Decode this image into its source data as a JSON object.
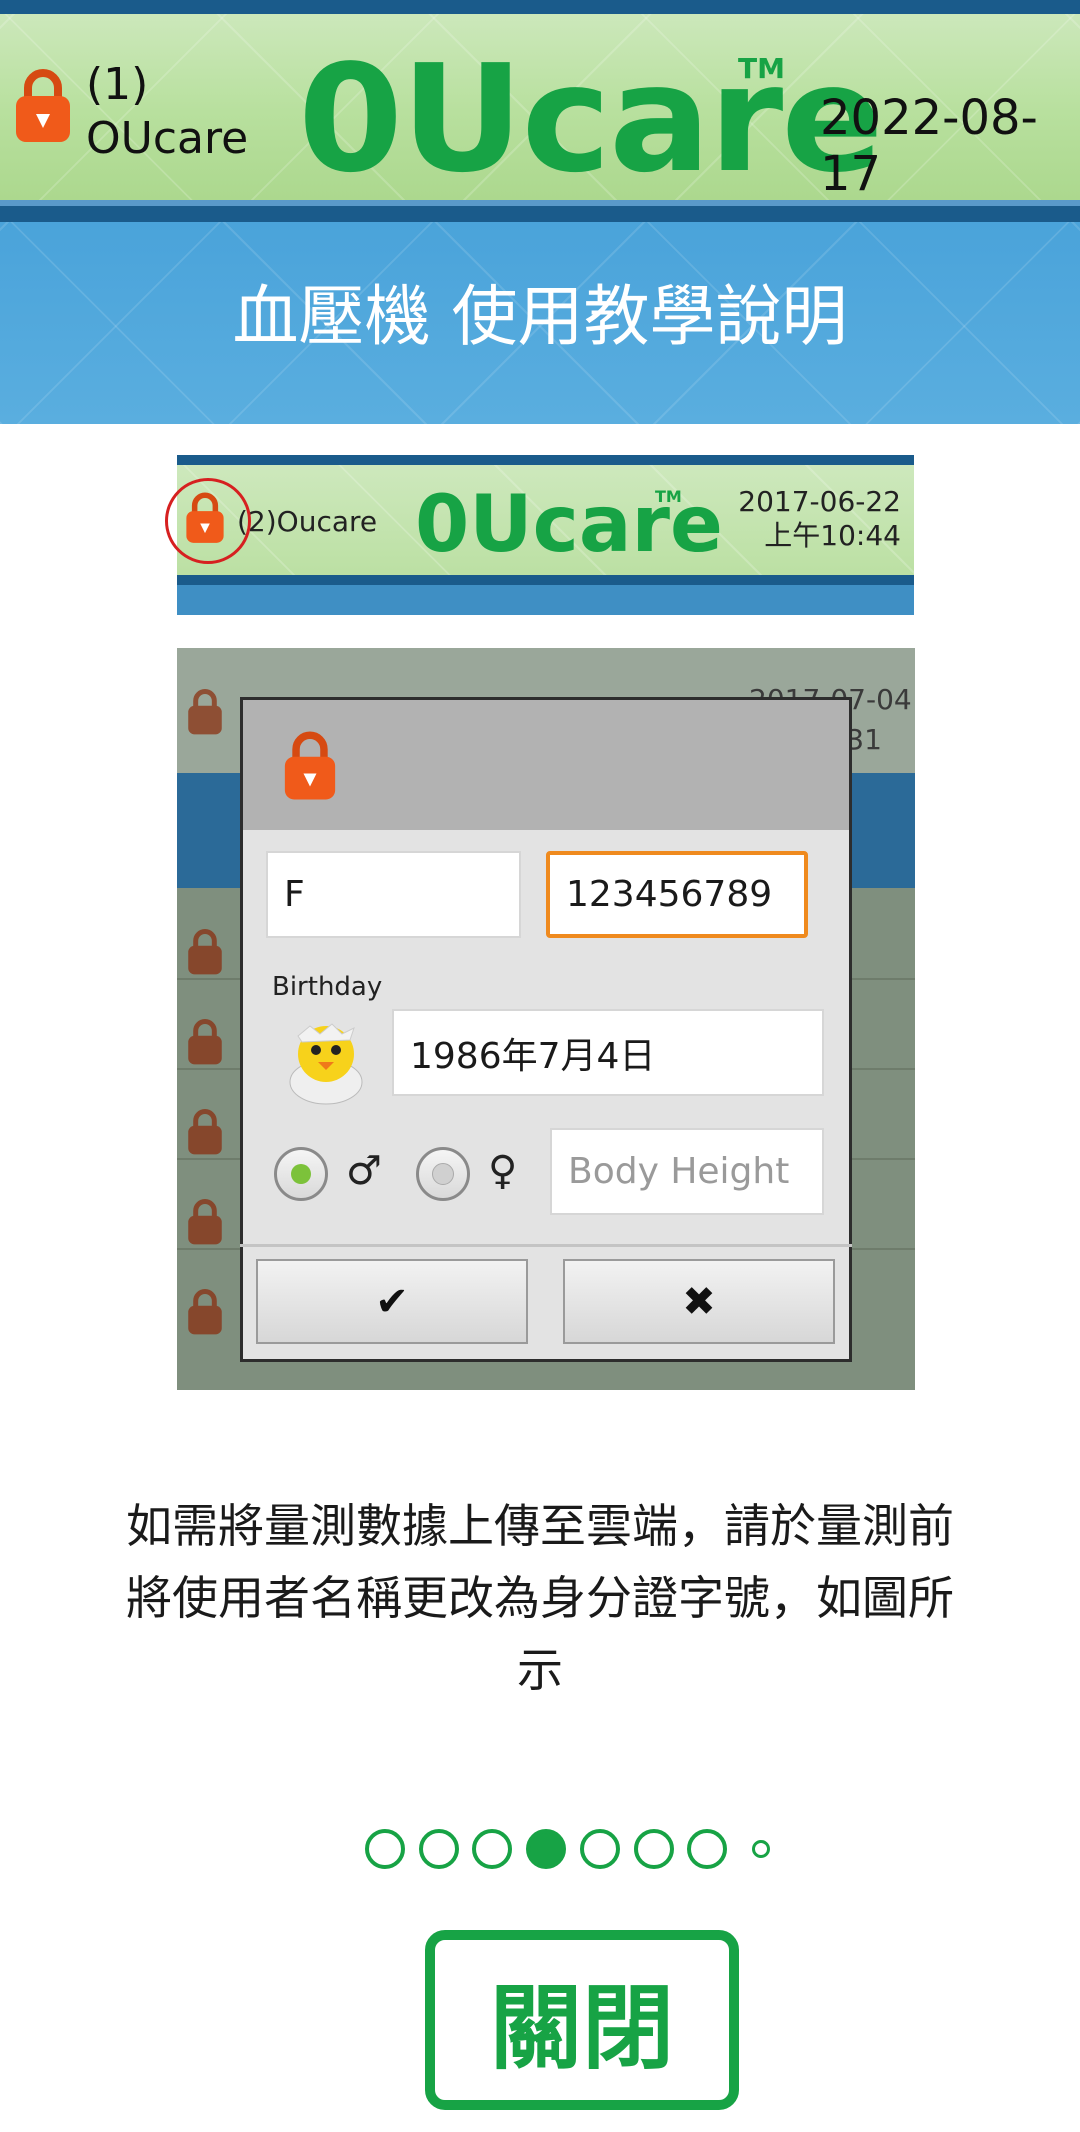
{
  "header": {
    "user_label": "(1)\nOUcare",
    "logo": "0Ucare",
    "trademark": "TM",
    "date": "2022-08-17"
  },
  "banner": {
    "title": "血壓機 使用教學說明"
  },
  "figure_header": {
    "user_label": "(2)Oucare",
    "logo": "0Ucare",
    "trademark": "TM",
    "date": "2017-06-22",
    "time": "上午10:44"
  },
  "figure_dialog": {
    "background_date": "2017-07-04",
    "background_time": "4:31",
    "name_value": "F",
    "id_value": "123456789",
    "birthday_label": "Birthday",
    "birthday_value": "1986年7月4日",
    "male_symbol": "♂",
    "female_symbol": "♀",
    "height_placeholder": "Body Height",
    "confirm_label": "✔",
    "cancel_label": "✖"
  },
  "description": "如需將量測數據上傳至雲端，請於量測前將使用者名稱更改為身分證字號，如圖所示",
  "pager": {
    "total": 8,
    "current": 4
  },
  "close_label": "關閉",
  "colors": {
    "brand_green": "#17a345",
    "header_blue": "#1a5b8b",
    "banner_blue": "#4aa3da",
    "lock_orange": "#f05a1a",
    "focus_orange": "#ef8a1e"
  }
}
